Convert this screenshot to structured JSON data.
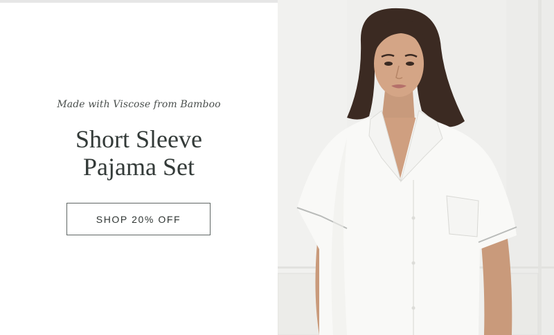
{
  "promo": {
    "eyebrow": "Made with Viscose from Bamboo",
    "title_line1": "Short Sleeve",
    "title_line2": "Pajama Set",
    "cta_label": "SHOP 20% OFF"
  },
  "colors": {
    "text_dark": "#333a38",
    "button_border": "#5f6664",
    "photo_bg": "#eeeeec",
    "garment": "#f9f9f7"
  }
}
